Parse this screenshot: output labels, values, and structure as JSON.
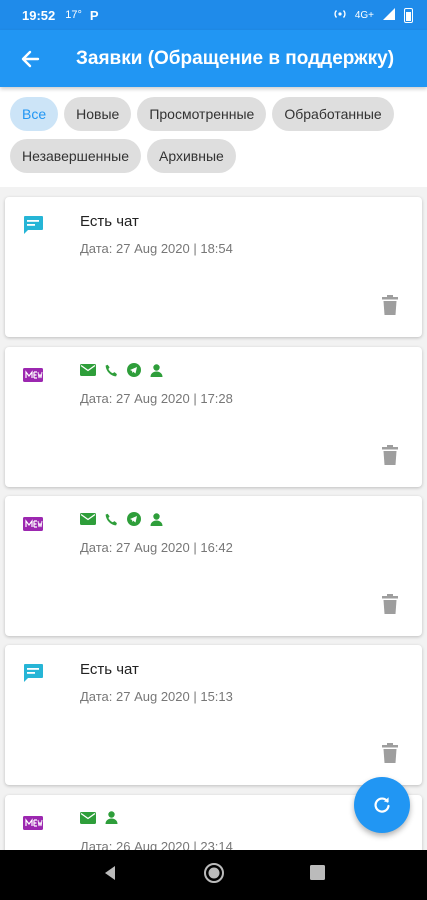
{
  "status_bar": {
    "time": "19:52",
    "temperature": "17°",
    "carrier_glyph": "P",
    "network": "4G+"
  },
  "app_bar": {
    "title": "Заявки (Обращение в поддержку)",
    "back_icon": "arrow-back-icon"
  },
  "filters": [
    {
      "label": "Все",
      "active": true
    },
    {
      "label": "Новые",
      "active": false
    },
    {
      "label": "Просмотренные",
      "active": false
    },
    {
      "label": "Обработанные",
      "active": false
    },
    {
      "label": "Незавершенные",
      "active": false
    },
    {
      "label": "Архивные",
      "active": false
    }
  ],
  "requests": [
    {
      "type": "chat",
      "title": "Есть чат",
      "date": "Дата: 27 Aug 2020 | 18:54"
    },
    {
      "type": "new",
      "contacts": [
        "email",
        "phone",
        "telegram",
        "person"
      ],
      "date": "Дата: 27 Aug 2020 | 17:28"
    },
    {
      "type": "new",
      "contacts": [
        "email",
        "phone",
        "telegram",
        "person"
      ],
      "date": "Дата: 27 Aug 2020 | 16:42"
    },
    {
      "type": "chat",
      "title": "Есть чат",
      "date": "Дата: 27 Aug 2020 | 15:13"
    },
    {
      "type": "new",
      "contacts": [
        "email",
        "person"
      ],
      "date": "Дата: 26 Aug 2020 | 23:14"
    }
  ],
  "colors": {
    "primary": "#2196f3",
    "chat_icon": "#26b5d6",
    "new_icon": "#9c27b0",
    "contact_icon": "#2e9e3a",
    "trash": "#9e9e9e"
  },
  "fab": {
    "icon": "refresh-icon"
  }
}
